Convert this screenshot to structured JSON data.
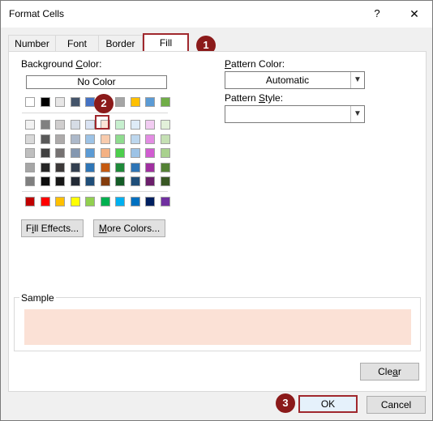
{
  "window": {
    "title": "Format Cells",
    "help": "?",
    "close": "✕"
  },
  "tabs": [
    {
      "label": "Number"
    },
    {
      "label": "Font"
    },
    {
      "label": "Border"
    },
    {
      "label": "Fill",
      "active": true
    }
  ],
  "fill": {
    "background_label": "Background Color:",
    "no_color_label": "No Color",
    "fill_effects_label": "Fill Effects...",
    "more_colors_label": "More Colors...",
    "pattern_color_label": "Pattern Color:",
    "pattern_color_value": "Automatic",
    "pattern_style_label": "Pattern Style:",
    "pattern_style_value": "",
    "sample_label": "Sample",
    "sample_color": "#fbe1d6",
    "clear_label": "Clear"
  },
  "palette": {
    "theme_row": [
      "#ffffff",
      "#000000",
      "#e7e6e6",
      "#44546a",
      "#4472c4",
      "#ed7d31",
      "#a5a5a5",
      "#ffc000",
      "#5b9bd5",
      "#70ad47"
    ],
    "tints": [
      [
        "#f2f2f2",
        "#808080",
        "#d0cece",
        "#d6dce5",
        "#dae3f3",
        "#fbe5d6",
        "#c6efce",
        "#deebf7",
        "#f2ccf2",
        "#e2f0d9"
      ],
      [
        "#d9d9d9",
        "#595959",
        "#aeabab",
        "#adb9ca",
        "#9dc3e6",
        "#f8cbad",
        "#8fdc8f",
        "#bdd7ee",
        "#e38de3",
        "#c5e0b4"
      ],
      [
        "#bfbfbf",
        "#404040",
        "#757171",
        "#8497b0",
        "#5b9bd5",
        "#f4b183",
        "#4cce4c",
        "#9dc3e6",
        "#d15cd1",
        "#a9d18e"
      ],
      [
        "#a6a6a6",
        "#262626",
        "#3b3838",
        "#333f50",
        "#2e75b6",
        "#c55a11",
        "#1e8a3a",
        "#2e75b6",
        "#a02fa0",
        "#548235"
      ],
      [
        "#7f7f7f",
        "#0d0d0d",
        "#171717",
        "#222a35",
        "#1f4e79",
        "#843c0c",
        "#145c27",
        "#1f4e79",
        "#6b1f6b",
        "#385723"
      ]
    ],
    "standard_row": [
      "#c00000",
      "#ff0000",
      "#ffc000",
      "#ffff00",
      "#92d050",
      "#00b050",
      "#00b0f0",
      "#0070c0",
      "#002060",
      "#7030a0"
    ]
  },
  "actions": {
    "ok_label": "OK",
    "cancel_label": "Cancel"
  },
  "badges": [
    "1",
    "2",
    "3"
  ]
}
